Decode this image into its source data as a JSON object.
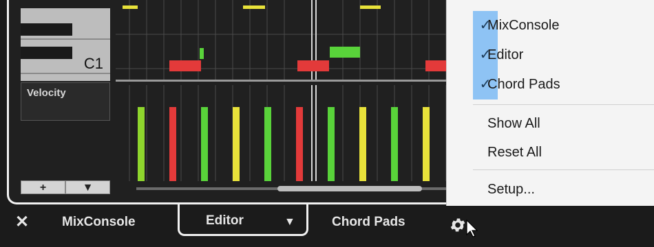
{
  "piano": {
    "note_label": "C1"
  },
  "velocity_lane": {
    "label": "Velocity",
    "add_button": "+",
    "dropdown_button": "▼"
  },
  "tabs": {
    "close": "✕",
    "mixconsole": "MixConsole",
    "editor": "Editor",
    "editor_dropdown": "▼",
    "chord_pads": "Chord Pads",
    "settings_icon": "gear-icon"
  },
  "menu": {
    "items": [
      {
        "label": "MixConsole",
        "checked": true,
        "check": "✓"
      },
      {
        "label": "Editor",
        "checked": true,
        "check": "✓"
      },
      {
        "label": "Chord Pads",
        "checked": true,
        "check": "✓"
      },
      {
        "label": "Show All",
        "checked": false
      },
      {
        "label": "Reset All",
        "checked": false
      },
      {
        "label": "Setup...",
        "checked": false
      }
    ]
  },
  "colors": {
    "accent_check": "#8ec3f4",
    "note_red": "#e33a3a",
    "note_green": "#59d33a",
    "note_yellow": "#e8e23a"
  }
}
